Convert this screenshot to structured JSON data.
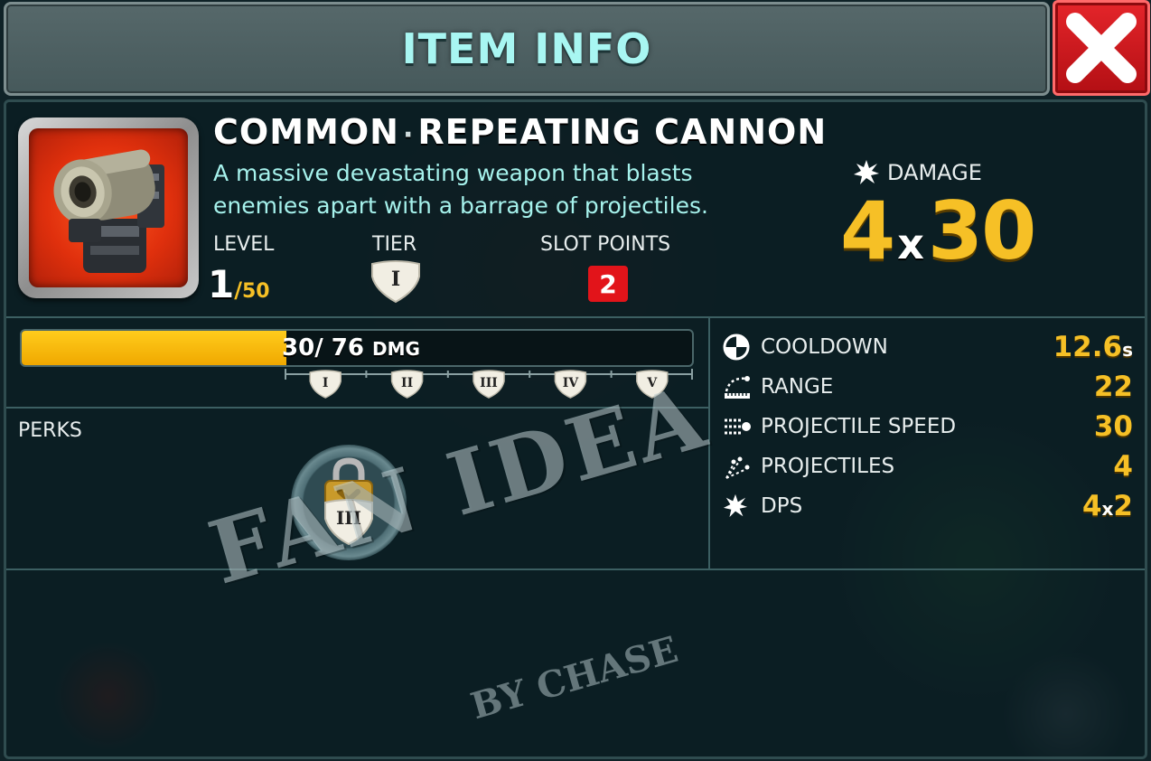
{
  "header": {
    "title": "ITEM INFO"
  },
  "item": {
    "rarity": "COMMON",
    "name": "REPEATING CANNON",
    "description": "A massive devastating weapon that blasts enemies apart with a barrage of projectiles.",
    "level_label": "LEVEL",
    "level_current": "1",
    "level_max": "50",
    "tier_label": "TIER",
    "tier_value": "I",
    "slot_points_label": "SLOT POINTS",
    "slot_points_value": "2"
  },
  "damage": {
    "label": "DAMAGE",
    "count": "4",
    "x": "x",
    "value": "30"
  },
  "progress": {
    "current": "30",
    "max": "76",
    "unit": "DMG",
    "fraction": 0.395,
    "tiers": [
      "I",
      "II",
      "III",
      "IV",
      "V"
    ]
  },
  "perks": {
    "label": "PERKS",
    "locked_tier": "III"
  },
  "stats": [
    {
      "icon": "cooldown-icon",
      "name": "COOLDOWN",
      "value": "12.6",
      "suffix": "s"
    },
    {
      "icon": "range-icon",
      "name": "RANGE",
      "value": "22",
      "suffix": ""
    },
    {
      "icon": "projectile-speed-icon",
      "name": "PROJECTILE SPEED",
      "value": "30",
      "suffix": ""
    },
    {
      "icon": "projectiles-icon",
      "name": "PROJECTILES",
      "value": "4",
      "suffix": ""
    },
    {
      "icon": "burst-icon",
      "name": "DPS",
      "value": "4",
      "mid": "x",
      "value2": "2"
    }
  ],
  "watermark": {
    "main": "FAN IDEA",
    "sub": "BY CHASE"
  },
  "colors": {
    "accent_gold": "#f6c026",
    "header_text": "#a8f6f2",
    "close_red": "#e2141a",
    "description_text": "#a6f2ec"
  }
}
